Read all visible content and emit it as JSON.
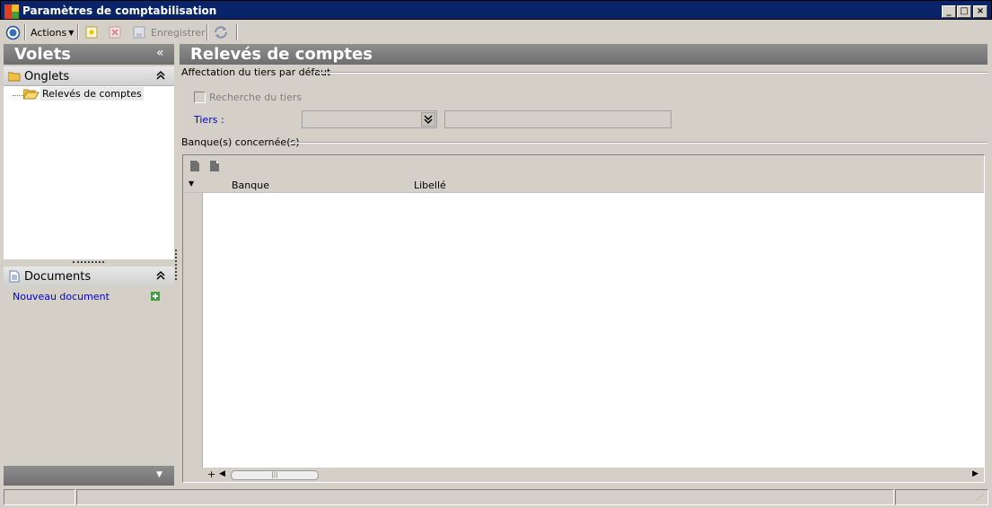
{
  "window": {
    "title": "Paramètres de comptabilisation"
  },
  "toolbar": {
    "actions_label": "Actions",
    "save_label": "Enregistrer"
  },
  "left_panel": {
    "header": "Volets",
    "collapse_glyph": "«",
    "onglets": {
      "title": "Onglets",
      "items": [
        {
          "label": "Relevés de comptes"
        }
      ]
    },
    "documents": {
      "title": "Documents",
      "new_document": "Nouveau document"
    }
  },
  "main": {
    "header": "Relevés de comptes",
    "affectation": {
      "group_label": "Affectation du tiers par défaut",
      "search_checkbox_label": "Recherche du tiers",
      "tiers_label": "Tiers  :",
      "tiers_value": "",
      "tiers_text": ""
    },
    "banques": {
      "group_label": "Banque(s) concernée(s)",
      "columns": [
        "Banque",
        "Libellé"
      ],
      "rows": []
    }
  },
  "colors": {
    "titlebar": "#0a246a",
    "link": "#0000cc",
    "header_gray": "#7a7a7a"
  }
}
